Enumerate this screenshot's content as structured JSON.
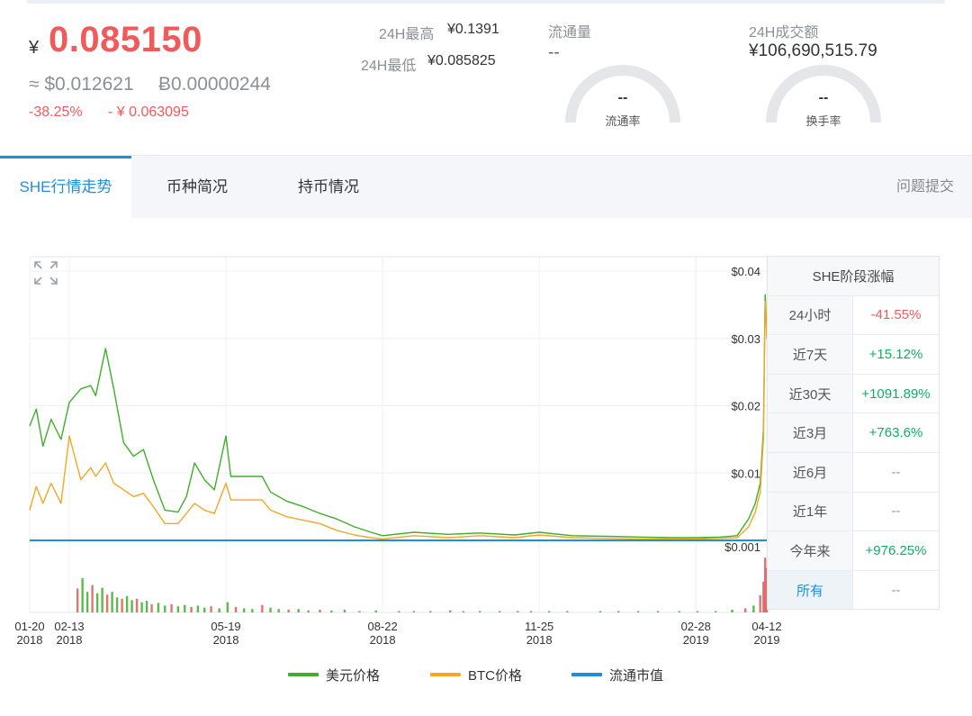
{
  "price": {
    "currency": "¥",
    "main": "0.085150",
    "usd": "≈ $0.012621",
    "btc": "Ƀ0.00000244",
    "change_pct": "-38.25%",
    "change_amt": "- ¥ 0.063095"
  },
  "high_low": {
    "high_label": "24H最高",
    "high_value": "¥0.1391",
    "low_label": "24H最低",
    "low_value": "¥0.085825"
  },
  "circulation": {
    "title": "流通量",
    "value": "--",
    "gauge_value": "--",
    "gauge_label": "流通率"
  },
  "volume": {
    "title": "24H成交额",
    "value": "¥106,690,515.79",
    "gauge_value": "--",
    "gauge_label": "换手率"
  },
  "tabs": [
    {
      "label": "SHE行情走势"
    },
    {
      "label": "币种简况"
    },
    {
      "label": "持币情况"
    }
  ],
  "feedback": "问题提交",
  "side_table": {
    "title": "SHE阶段涨幅",
    "rows": [
      {
        "label": "24小时",
        "value": "-41.55%"
      },
      {
        "label": "近7天",
        "value": "+15.12%"
      },
      {
        "label": "近30天",
        "value": "+1091.89%"
      },
      {
        "label": "近3月",
        "value": "+763.6%"
      },
      {
        "label": "近6月",
        "value": "--"
      },
      {
        "label": "近1年",
        "value": "--"
      },
      {
        "label": "今年来",
        "value": "+976.25%"
      },
      {
        "label": "所有",
        "value": "--"
      }
    ]
  },
  "legend": [
    {
      "label": "美元价格",
      "color": "#3fae29"
    },
    {
      "label": "BTC价格",
      "color": "#f5a623"
    },
    {
      "label": "流通市值",
      "color": "#1f8fdb"
    }
  ],
  "chart_data": {
    "type": "line",
    "x_ticks": [
      {
        "date": "2018-01-20",
        "label": [
          "01-20",
          "2018"
        ]
      },
      {
        "date": "2018-02-13",
        "label": [
          "02-13",
          "2018"
        ]
      },
      {
        "date": "2018-05-19",
        "label": [
          "05-19",
          "2018"
        ]
      },
      {
        "date": "2018-08-22",
        "label": [
          "08-22",
          "2018"
        ]
      },
      {
        "date": "2018-11-25",
        "label": [
          "11-25",
          "2018"
        ]
      },
      {
        "date": "2019-02-28",
        "label": [
          "02-28",
          "2019"
        ]
      },
      {
        "date": "2019-04-12",
        "label": [
          "04-12",
          "2019"
        ]
      }
    ],
    "y_ticks": [
      "$0.04",
      "$0.03",
      "$0.02",
      "$0.01"
    ],
    "y_values": [
      0.04,
      0.03,
      0.02,
      0.01
    ],
    "ylim": [
      0,
      0.04
    ],
    "volume_tick": "$0.001",
    "series": [
      {
        "name": "美元价格",
        "color": "#3fae29",
        "points": [
          [
            "2018-01-20",
            0.017
          ],
          [
            "2018-01-24",
            0.0195
          ],
          [
            "2018-01-28",
            0.014
          ],
          [
            "2018-02-02",
            0.018
          ],
          [
            "2018-02-08",
            0.015
          ],
          [
            "2018-02-13",
            0.0205
          ],
          [
            "2018-02-20",
            0.0225
          ],
          [
            "2018-02-26",
            0.023
          ],
          [
            "2018-03-01",
            0.0215
          ],
          [
            "2018-03-07",
            0.0285
          ],
          [
            "2018-03-12",
            0.0225
          ],
          [
            "2018-03-18",
            0.0145
          ],
          [
            "2018-03-24",
            0.0125
          ],
          [
            "2018-03-30",
            0.0135
          ],
          [
            "2018-04-05",
            0.009
          ],
          [
            "2018-04-12",
            0.0045
          ],
          [
            "2018-04-20",
            0.0042
          ],
          [
            "2018-04-25",
            0.0065
          ],
          [
            "2018-04-30",
            0.0115
          ],
          [
            "2018-05-06",
            0.009
          ],
          [
            "2018-05-12",
            0.0075
          ],
          [
            "2018-05-19",
            0.0155
          ],
          [
            "2018-05-22",
            0.0095
          ],
          [
            "2018-06-10",
            0.0095
          ],
          [
            "2018-06-15",
            0.0072
          ],
          [
            "2018-06-25",
            0.0058
          ],
          [
            "2018-07-05",
            0.005
          ],
          [
            "2018-07-15",
            0.004
          ],
          [
            "2018-07-25",
            0.0032
          ],
          [
            "2018-08-05",
            0.002
          ],
          [
            "2018-08-15",
            0.0012
          ],
          [
            "2018-08-22",
            0.0007
          ],
          [
            "2018-09-10",
            0.0012
          ],
          [
            "2018-10-01",
            0.0009
          ],
          [
            "2018-10-20",
            0.0011
          ],
          [
            "2018-11-10",
            0.0008
          ],
          [
            "2018-11-25",
            0.0012
          ],
          [
            "2018-12-15",
            0.0007
          ],
          [
            "2019-01-05",
            0.0006
          ],
          [
            "2019-01-25",
            0.0005
          ],
          [
            "2019-02-15",
            0.0004
          ],
          [
            "2019-02-28",
            0.0004
          ],
          [
            "2019-03-15",
            0.0005
          ],
          [
            "2019-03-25",
            0.0007
          ],
          [
            "2019-04-01",
            0.0032
          ],
          [
            "2019-04-05",
            0.0055
          ],
          [
            "2019-04-08",
            0.0085
          ],
          [
            "2019-04-10",
            0.0165
          ],
          [
            "2019-04-11",
            0.0365
          ],
          [
            "2019-04-12",
            0.031
          ]
        ]
      },
      {
        "name": "BTC价格",
        "color": "#f5a623",
        "points": [
          [
            "2018-01-20",
            0.0045
          ],
          [
            "2018-01-24",
            0.008
          ],
          [
            "2018-01-28",
            0.0055
          ],
          [
            "2018-02-02",
            0.0085
          ],
          [
            "2018-02-08",
            0.0055
          ],
          [
            "2018-02-13",
            0.0155
          ],
          [
            "2018-02-20",
            0.009
          ],
          [
            "2018-02-26",
            0.0108
          ],
          [
            "2018-03-01",
            0.0095
          ],
          [
            "2018-03-07",
            0.0115
          ],
          [
            "2018-03-12",
            0.0085
          ],
          [
            "2018-03-18",
            0.0075
          ],
          [
            "2018-03-24",
            0.0065
          ],
          [
            "2018-03-30",
            0.007
          ],
          [
            "2018-04-05",
            0.005
          ],
          [
            "2018-04-12",
            0.0025
          ],
          [
            "2018-04-20",
            0.0025
          ],
          [
            "2018-04-25",
            0.004
          ],
          [
            "2018-04-30",
            0.0055
          ],
          [
            "2018-05-06",
            0.0045
          ],
          [
            "2018-05-12",
            0.004
          ],
          [
            "2018-05-19",
            0.0085
          ],
          [
            "2018-05-22",
            0.006
          ],
          [
            "2018-06-10",
            0.006
          ],
          [
            "2018-06-15",
            0.0045
          ],
          [
            "2018-06-25",
            0.0035
          ],
          [
            "2018-07-05",
            0.003
          ],
          [
            "2018-07-15",
            0.0025
          ],
          [
            "2018-07-25",
            0.0015
          ],
          [
            "2018-08-05",
            0.0008
          ],
          [
            "2018-08-15",
            0.0004
          ],
          [
            "2018-08-22",
            0.0002
          ],
          [
            "2018-09-10",
            0.0007
          ],
          [
            "2018-10-01",
            0.0004
          ],
          [
            "2018-10-20",
            0.0007
          ],
          [
            "2018-11-10",
            0.0004
          ],
          [
            "2018-11-25",
            0.0008
          ],
          [
            "2018-12-15",
            0.0004
          ],
          [
            "2019-01-05",
            0.0003
          ],
          [
            "2019-01-25",
            0.0002
          ],
          [
            "2019-02-15",
            0.0002
          ],
          [
            "2019-02-28",
            0.0002
          ],
          [
            "2019-03-15",
            0.0003
          ],
          [
            "2019-03-25",
            0.0004
          ],
          [
            "2019-04-01",
            0.002
          ],
          [
            "2019-04-05",
            0.0042
          ],
          [
            "2019-04-08",
            0.0072
          ],
          [
            "2019-04-10",
            0.0152
          ],
          [
            "2019-04-11",
            0.0355
          ],
          [
            "2019-04-12",
            0.03
          ]
        ]
      },
      {
        "name": "流通市值",
        "color": "#1f8fdb",
        "points": [
          [
            "2018-01-20",
            0
          ],
          [
            "2019-04-12",
            0
          ]
        ]
      }
    ],
    "volume_bars": [
      [
        "2018-02-18",
        0.35
      ],
      [
        "2018-02-21",
        0.5
      ],
      [
        "2018-02-24",
        0.3
      ],
      [
        "2018-02-27",
        0.4
      ],
      [
        "2018-03-02",
        0.28
      ],
      [
        "2018-03-05",
        0.36
      ],
      [
        "2018-03-08",
        0.26
      ],
      [
        "2018-03-11",
        0.3
      ],
      [
        "2018-03-14",
        0.22
      ],
      [
        "2018-03-17",
        0.2
      ],
      [
        "2018-03-20",
        0.24
      ],
      [
        "2018-03-23",
        0.18
      ],
      [
        "2018-03-26",
        0.2
      ],
      [
        "2018-03-29",
        0.15
      ],
      [
        "2018-04-01",
        0.17
      ],
      [
        "2018-04-04",
        0.12
      ],
      [
        "2018-04-08",
        0.14
      ],
      [
        "2018-04-12",
        0.1
      ],
      [
        "2018-04-16",
        0.12
      ],
      [
        "2018-04-20",
        0.09
      ],
      [
        "2018-04-24",
        0.11
      ],
      [
        "2018-04-28",
        0.08
      ],
      [
        "2018-05-02",
        0.1
      ],
      [
        "2018-05-06",
        0.07
      ],
      [
        "2018-05-10",
        0.09
      ],
      [
        "2018-05-15",
        0.06
      ],
      [
        "2018-05-20",
        0.15
      ],
      [
        "2018-05-25",
        0.08
      ],
      [
        "2018-05-30",
        0.06
      ],
      [
        "2018-06-04",
        0.05
      ],
      [
        "2018-06-10",
        0.11
      ],
      [
        "2018-06-15",
        0.07
      ],
      [
        "2018-06-20",
        0.05
      ],
      [
        "2018-06-26",
        0.04
      ],
      [
        "2018-07-02",
        0.05
      ],
      [
        "2018-07-08",
        0.03
      ],
      [
        "2018-07-15",
        0.04
      ],
      [
        "2018-07-22",
        0.03
      ],
      [
        "2018-07-30",
        0.04
      ],
      [
        "2018-08-08",
        0.02
      ],
      [
        "2018-08-18",
        0.03
      ],
      [
        "2018-09-01",
        0.02
      ],
      [
        "2018-09-10",
        0.02
      ],
      [
        "2018-09-20",
        0.02
      ],
      [
        "2018-10-02",
        0.03
      ],
      [
        "2018-10-10",
        0.02
      ],
      [
        "2018-10-20",
        0.02
      ],
      [
        "2018-11-01",
        0.02
      ],
      [
        "2018-11-12",
        0.02
      ],
      [
        "2018-11-20",
        0.02
      ],
      [
        "2018-12-01",
        0.02
      ],
      [
        "2018-12-12",
        0.02
      ],
      [
        "2019-01-01",
        0.02
      ],
      [
        "2019-01-12",
        0.02
      ],
      [
        "2019-01-24",
        0.02
      ],
      [
        "2019-02-05",
        0.02
      ],
      [
        "2019-02-18",
        0.02
      ],
      [
        "2019-03-01",
        0.02
      ],
      [
        "2019-03-12",
        0.02
      ],
      [
        "2019-03-22",
        0.04
      ],
      [
        "2019-03-30",
        0.06
      ],
      [
        "2019-04-04",
        0.1
      ],
      [
        "2019-04-08",
        0.25
      ],
      [
        "2019-04-10",
        0.45
      ],
      [
        "2019-04-11",
        0.8
      ],
      [
        "2019-04-12",
        0.65
      ]
    ]
  }
}
